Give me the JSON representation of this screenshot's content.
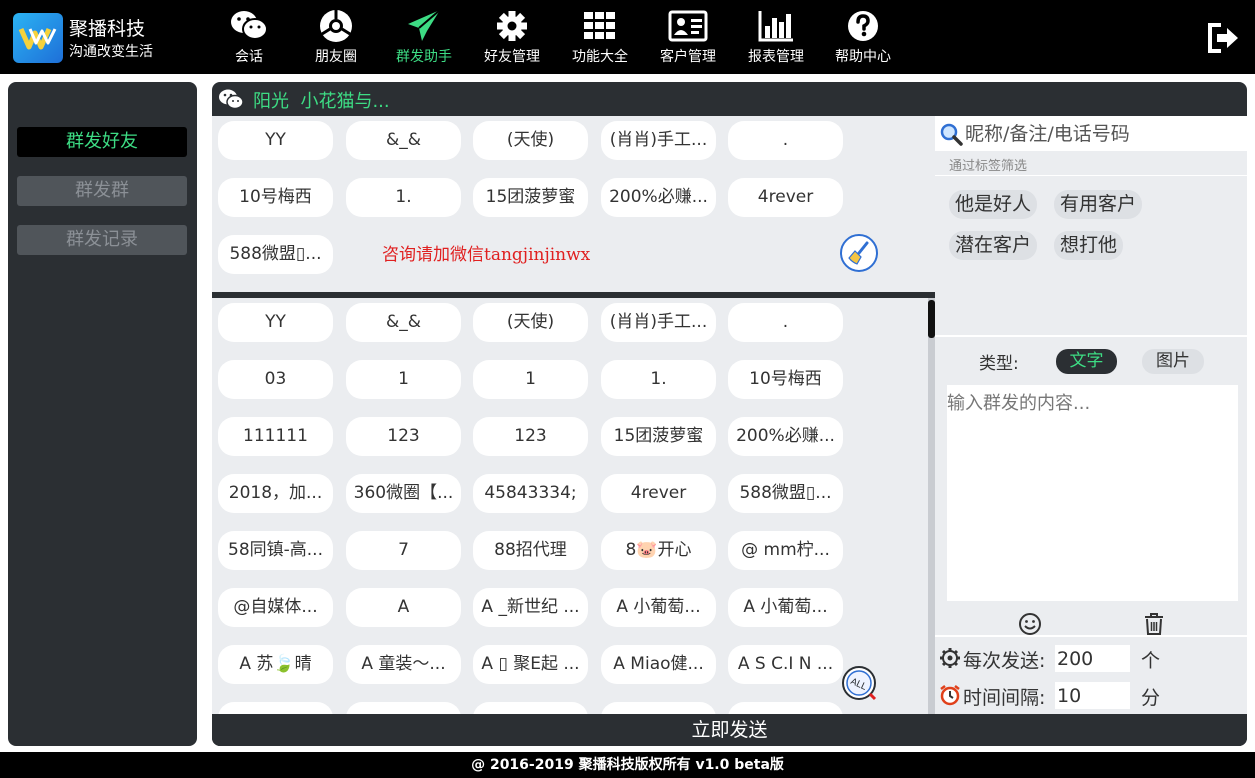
{
  "brand": {
    "name": "聚播科技",
    "slogan": "沟通改变生活"
  },
  "nav": [
    {
      "label": "会话",
      "icon": "wechat-icon"
    },
    {
      "label": "朋友圈",
      "icon": "moments-icon"
    },
    {
      "label": "群发助手",
      "icon": "paper-plane-icon",
      "active": true
    },
    {
      "label": "好友管理",
      "icon": "gear-icon"
    },
    {
      "label": "功能大全",
      "icon": "grid-icon"
    },
    {
      "label": "客户管理",
      "icon": "contact-card-icon"
    },
    {
      "label": "报表管理",
      "icon": "bar-chart-icon"
    },
    {
      "label": "帮助中心",
      "icon": "help-icon"
    }
  ],
  "sidebar": {
    "items": [
      {
        "label": "群发好友",
        "active": true
      },
      {
        "label": "群发群"
      },
      {
        "label": "群发记录"
      }
    ]
  },
  "account": {
    "title": "阳光  小花猫与..."
  },
  "selected_friends": [
    "YY",
    "&_&",
    "(天使)",
    "(肖肖)手工...",
    ".",
    "10号梅西",
    "1.",
    "15团菠萝蜜",
    "200%必赚...",
    "4rever",
    "588微盟▯..."
  ],
  "promo_text": "咨询请加微信tangjinjinwx",
  "all_friends": [
    "YY",
    "&_&",
    "(天使)",
    "(肖肖)手工...",
    ".",
    "03",
    "1",
    "1",
    "1.",
    "10号梅西",
    "111111",
    "123",
    "123",
    "15团菠萝蜜",
    "200%必赚...",
    "2018，加...",
    "360微圈【...",
    "45843334;",
    "4rever",
    "588微盟▯...",
    "58同镇-高...",
    "7",
    "88招代理",
    "8🐷开心",
    "@ mm柠...",
    "@自媒体...",
    "A",
    "A _新世纪 ...",
    "A 小葡萄...",
    "A 小葡萄...",
    "A 苏🍃晴",
    "A 童装～...",
    "A ▯ 聚E起 ...",
    "A Miao健...",
    "A S C.I N ..."
  ],
  "search": {
    "placeholder": "昵称/备注/电话号码"
  },
  "tag_filter_label": "通过标签筛选",
  "tags": [
    "他是好人",
    "有用客户",
    "潜在客户",
    "想打他"
  ],
  "message_type": {
    "label": "类型:",
    "text": "文字",
    "image": "图片"
  },
  "content": {
    "placeholder": "输入群发的内容..."
  },
  "options": {
    "per_send_label": "每次发送:",
    "per_send_value": "200",
    "per_send_unit": "个",
    "interval_label": "时间间隔:",
    "interval_value": "10",
    "interval_unit": "分"
  },
  "send_button": "立即发送",
  "footer": "@ 2016-2019 聚播科技版权所有 v1.0 beta版",
  "colors": {
    "accent": "#3ddc84",
    "panel": "#2b2f33",
    "promo": "#e02020"
  }
}
